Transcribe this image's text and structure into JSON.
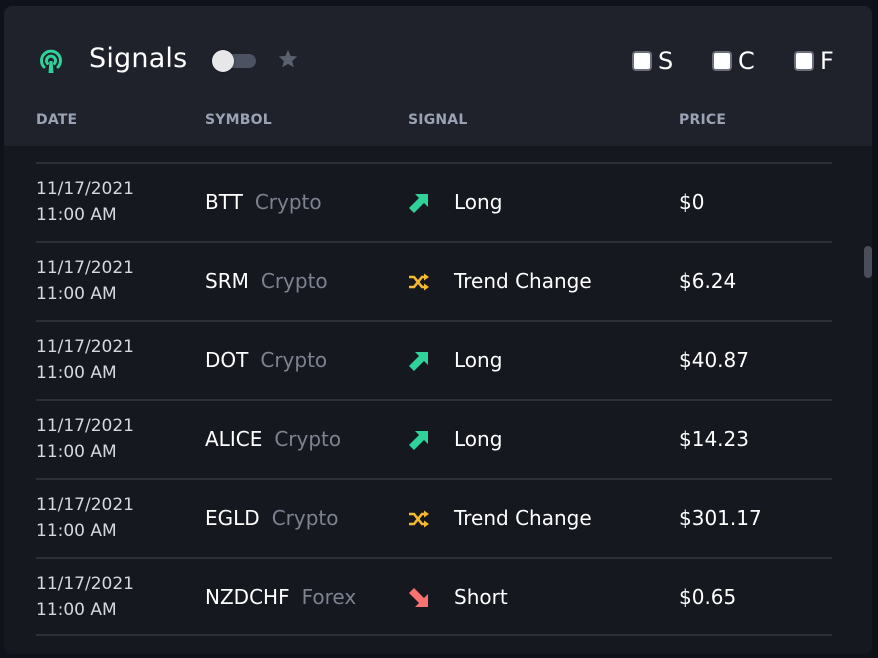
{
  "header": {
    "title": "Signals",
    "icon": "broadcast-signal-icon",
    "toggle_state": "off",
    "star_icon": "star-icon",
    "filters": [
      {
        "label": "S",
        "checked": false
      },
      {
        "label": "C",
        "checked": false
      },
      {
        "label": "F",
        "checked": false
      }
    ]
  },
  "columns": [
    "DATE",
    "SYMBOL",
    "SIGNAL",
    "PRICE"
  ],
  "colors": {
    "long": "#2fd39a",
    "trend_change": "#f5b82e",
    "short": "#f97272",
    "panel_bg": "#161820",
    "header_bg": "#1f222b"
  },
  "rows": [
    {
      "date": "11/17/2021",
      "time": "11:00 AM",
      "symbol": "BTT",
      "type": "Crypto",
      "signal": "Long",
      "signal_icon": "arrow-up-right-icon",
      "price": "$0"
    },
    {
      "date": "11/17/2021",
      "time": "11:00 AM",
      "symbol": "SRM",
      "type": "Crypto",
      "signal": "Trend Change",
      "signal_icon": "shuffle-icon",
      "price": "$6.24"
    },
    {
      "date": "11/17/2021",
      "time": "11:00 AM",
      "symbol": "DOT",
      "type": "Crypto",
      "signal": "Long",
      "signal_icon": "arrow-up-right-icon",
      "price": "$40.87"
    },
    {
      "date": "11/17/2021",
      "time": "11:00 AM",
      "symbol": "ALICE",
      "type": "Crypto",
      "signal": "Long",
      "signal_icon": "arrow-up-right-icon",
      "price": "$14.23"
    },
    {
      "date": "11/17/2021",
      "time": "11:00 AM",
      "symbol": "EGLD",
      "type": "Crypto",
      "signal": "Trend Change",
      "signal_icon": "shuffle-icon",
      "price": "$301.17"
    },
    {
      "date": "11/17/2021",
      "time": "11:00 AM",
      "symbol": "NZDCHF",
      "type": "Forex",
      "signal": "Short",
      "signal_icon": "arrow-down-right-icon",
      "price": "$0.65"
    }
  ]
}
